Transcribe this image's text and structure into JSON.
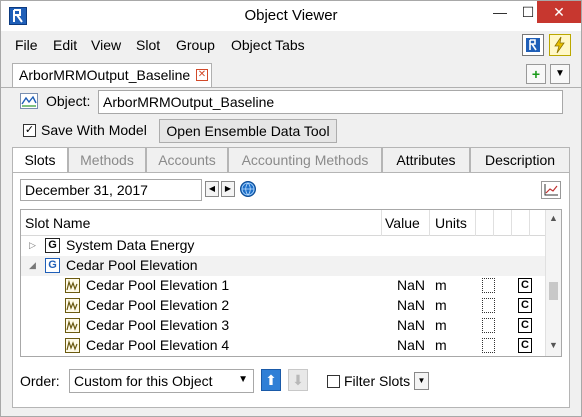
{
  "window": {
    "title": "Object Viewer",
    "minimize": "—",
    "maximize": "☐",
    "close": "✕"
  },
  "menu": {
    "items": [
      "File",
      "Edit",
      "View",
      "Slot",
      "Group",
      "Object Tabs"
    ]
  },
  "doc_tab": {
    "label": "ArborMRMOutput_Baseline",
    "close": "✕",
    "add": "+",
    "dropdown": "▼"
  },
  "object": {
    "label": "Object:",
    "value": "ArborMRMOutput_Baseline"
  },
  "save": {
    "label": "Save With Model",
    "checked": true,
    "check_glyph": "✓"
  },
  "ensemble_button": "Open Ensemble Data Tool",
  "tabs": [
    {
      "label": "Slots",
      "state": "active"
    },
    {
      "label": "Methods",
      "state": "disabled"
    },
    {
      "label": "Accounts",
      "state": "disabled"
    },
    {
      "label": "Accounting Methods",
      "state": "disabled"
    },
    {
      "label": "Attributes",
      "state": "enabled"
    },
    {
      "label": "Description",
      "state": "enabled"
    }
  ],
  "date": {
    "value": "December 31, 2017",
    "prev": "◀",
    "next": "▶"
  },
  "table": {
    "headers": {
      "name": "Slot Name",
      "value": "Value",
      "units": "Units"
    },
    "groups": [
      {
        "expander": "▷",
        "icon": "G",
        "label": "System Data Energy"
      },
      {
        "expander": "◢",
        "icon": "G",
        "label": "Cedar Pool Elevation"
      }
    ],
    "rows": [
      {
        "label": "Cedar Pool Elevation 1",
        "value": "NaN",
        "units": "m",
        "c": "C"
      },
      {
        "label": "Cedar Pool Elevation 2",
        "value": "NaN",
        "units": "m",
        "c": "C"
      },
      {
        "label": "Cedar Pool Elevation 3",
        "value": "NaN",
        "units": "m",
        "c": "C"
      },
      {
        "label": "Cedar Pool Elevation 4",
        "value": "NaN",
        "units": "m",
        "c": "C"
      }
    ],
    "scroll": {
      "up": "▲",
      "down": "▼"
    }
  },
  "order": {
    "label": "Order:",
    "value": "Custom for this Object",
    "caret": "▼",
    "up": "⬆",
    "down": "⬇"
  },
  "filter": {
    "label": "Filter Slots",
    "checked": false,
    "dropdown": "▼"
  },
  "colors": {
    "accent": "#1f5fb8",
    "close": "#c7372f"
  }
}
